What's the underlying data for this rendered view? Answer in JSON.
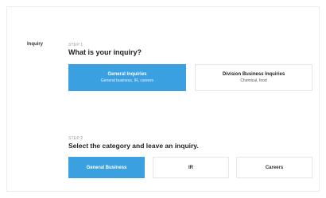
{
  "section_label": "Inquiry",
  "step1": {
    "tag": "STEP 1",
    "title": "What is your inquiry?",
    "options": [
      {
        "title": "General Inquiries",
        "subtitle": "General business, IR, careers",
        "selected": true
      },
      {
        "title": "Division Business Inquiries",
        "subtitle": "Chemical, food",
        "selected": false
      }
    ]
  },
  "step2": {
    "tag": "STEP 2",
    "title": "Select the category and leave an inquiry.",
    "categories": [
      {
        "label": "General Business",
        "selected": true
      },
      {
        "label": "IR",
        "selected": false
      },
      {
        "label": "Careers",
        "selected": false
      }
    ]
  },
  "colors": {
    "accent": "#3aa0e0",
    "border": "#e6e6e6",
    "muted_text": "#9a9a9a"
  }
}
